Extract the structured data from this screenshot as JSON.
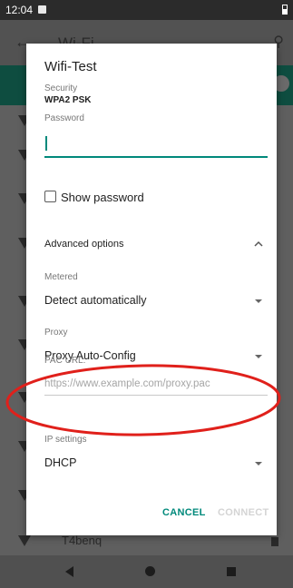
{
  "status_bar": {
    "time": "12:04"
  },
  "background_screen": {
    "title": "Wi-Fi",
    "partial_item_label": "T4benq"
  },
  "dialog": {
    "title": "Wifi-Test",
    "security_label": "Security",
    "security_value": "WPA2 PSK",
    "password_label": "Password",
    "password_value": "",
    "show_password_label": "Show password",
    "show_password_checked": false,
    "advanced_options_label": "Advanced options",
    "metered_label": "Metered",
    "metered_value": "Detect automatically",
    "proxy_label": "Proxy",
    "proxy_value": "Proxy Auto-Config",
    "pac_url_label": "PAC URL:",
    "pac_url_placeholder": "https://www.example.com/proxy.pac",
    "ip_settings_label": "IP settings",
    "ip_settings_value": "DHCP",
    "cancel_label": "CANCEL",
    "connect_label": "CONNECT"
  },
  "colors": {
    "accent": "#00897b",
    "annotation": "#e0201b",
    "disabled": "#d4d4d4"
  },
  "icons": {
    "back": "arrow-left-icon",
    "search": "search-icon",
    "chevron": "chevron-up-icon",
    "dropdown": "dropdown-triangle-icon",
    "nav_back": "nav-back-icon",
    "nav_home": "nav-home-icon",
    "nav_recents": "nav-recents-icon"
  }
}
